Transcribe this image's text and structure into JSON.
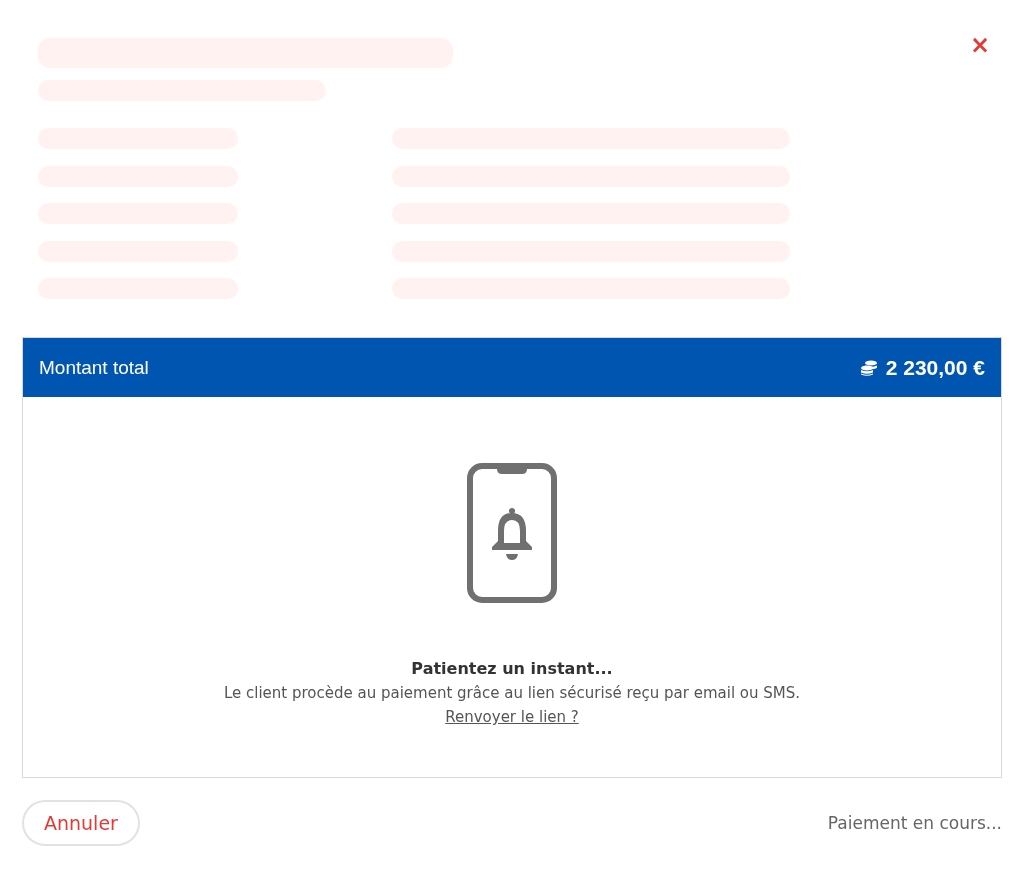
{
  "close_button": {
    "label": "×"
  },
  "total": {
    "label": "Montant total",
    "amount": "2 230,00 €"
  },
  "status_message": {
    "title": "Patientez un instant...",
    "text": "Le client procède au paiement grâce au lien sécurisé reçu par email ou SMS.",
    "link": "Renvoyer le lien ?"
  },
  "footer": {
    "cancel_button": "Annuler",
    "status": "Paiement en cours..."
  }
}
